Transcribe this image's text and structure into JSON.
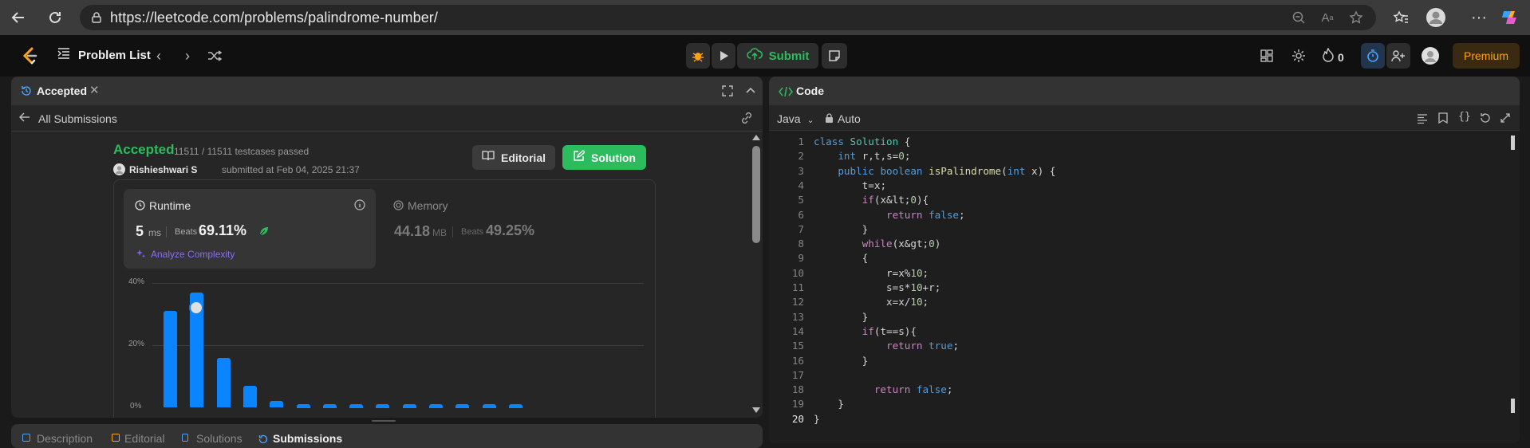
{
  "browser": {
    "url": "https://leetcode.com/problems/palindrome-number/"
  },
  "nav": {
    "problem_list": "Problem List",
    "submit": "Submit",
    "streak": "0",
    "premium": "Premium"
  },
  "left_panel": {
    "tab_title": "Accepted",
    "back_label": "All Submissions",
    "status": "Accepted",
    "testcases": "11511 / 11511 testcases passed",
    "user": "Rishieshwari S",
    "submitted_text": "submitted at Feb 04, 2025 21:37",
    "editorial_btn": "Editorial",
    "solution_btn": "Solution",
    "runtime": {
      "label": "Runtime",
      "value": "5",
      "unit": "ms",
      "beats_label": "Beats",
      "beats_value": "69.11%"
    },
    "memory": {
      "label": "Memory",
      "value": "44.18",
      "unit": "MB",
      "beats_label": "Beats",
      "beats_value": "49.25%"
    },
    "analyze": "Analyze Complexity",
    "chart_y_labels": [
      "40%",
      "20%",
      "0%"
    ],
    "bottom_tabs": [
      "Description",
      "Editorial",
      "Solutions",
      "Submissions"
    ]
  },
  "chart_data": {
    "type": "bar",
    "title": "",
    "ylabel": "",
    "ylim": [
      0,
      40
    ],
    "categories": [
      "b1",
      "b2",
      "b3",
      "b4",
      "b5",
      "b6",
      "b7",
      "b8",
      "b9",
      "b10",
      "b11",
      "b12",
      "b13",
      "b14"
    ],
    "values": [
      31,
      37,
      16,
      7,
      2,
      1,
      1,
      1,
      1,
      1,
      1,
      1,
      1,
      1
    ],
    "highlight_index": 1
  },
  "code_panel": {
    "title": "Code",
    "language": "Java",
    "mode": "Auto",
    "lines": [
      "class Solution {",
      "    int r,t,s=0;",
      "    public boolean isPalindrome(int x) {",
      "        t=x;",
      "        if(x<0){",
      "            return false;",
      "        }",
      "        while(x>0)",
      "        {",
      "            r=x%10;",
      "            s=s*10+r;",
      "            x=x/10;",
      "        }",
      "        if(t==s){",
      "            return true;",
      "        }",
      "",
      "          return false;",
      "    }",
      "}"
    ]
  },
  "colors": {
    "accent_green": "#2cbb5d",
    "accent_blue": "#0a84ff",
    "premium": "#ffa116"
  }
}
